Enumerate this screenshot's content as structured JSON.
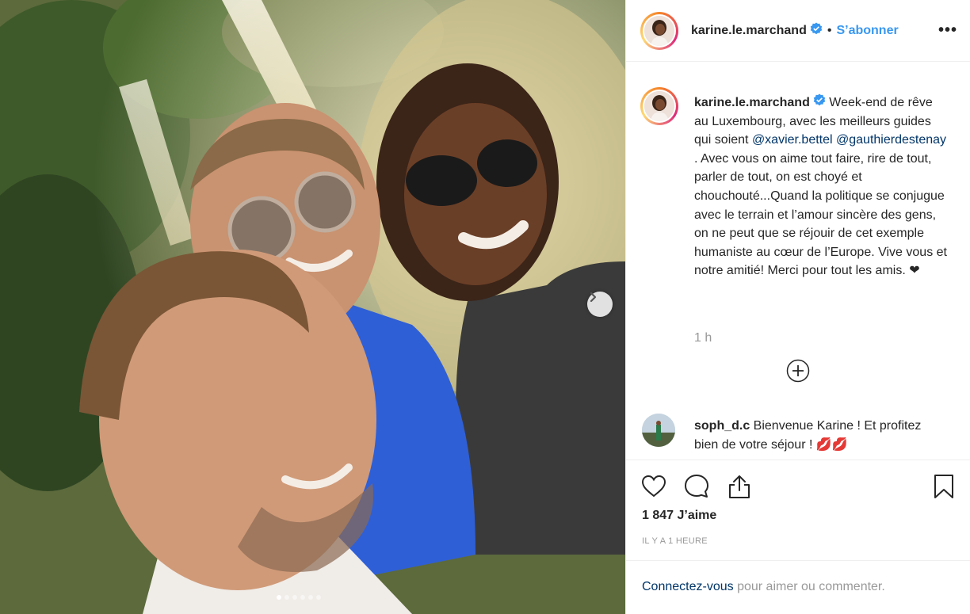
{
  "post": {
    "author": {
      "username": "karine.le.marchand",
      "verified": true,
      "avatar": "profile-photo"
    },
    "header": {
      "separator": "•",
      "follow_label": "S’abonner",
      "more_label": "•••"
    },
    "photo": {
      "alt": "selfie-waterfall",
      "carousel_count": 6,
      "carousel_active_index": 0,
      "next_icon": "chevron-right-icon"
    },
    "caption": {
      "username": "karine.le.marchand",
      "text_before": " Week-end de rêve au Luxembourg, avec les meilleurs guides qui soient ",
      "mention_1": "@xavier.bettel",
      "mention_2": "@gauthierdestenay",
      "text_after": " . Avec vous on aime tout faire, rire de tout, parler de tout, on est choyé et chouchouté...Quand la politique se conjugue avec le terrain et l’amour sincère des gens, on ne peut que se réjouir de cet exemple humaniste au cœur de l’Europe. Vive vous et notre amitié! Merci pour tout les amis. ❤",
      "time": "1 h"
    },
    "comments": [
      {
        "username": "soph_d.c",
        "text": " Bienvenue Karine ! Et profitez bien de votre séjour ! 💋💋"
      }
    ],
    "likes_label": "1 847 J’aime",
    "posted_label": "IL Y A 1 HEURE",
    "login": {
      "link": "Connectez-vous",
      "rest": " pour aimer ou commenter."
    },
    "icons": {
      "like": "heart-icon",
      "comment": "comment-bubble-icon",
      "share": "share-icon",
      "save": "bookmark-icon",
      "load_more": "plus-circle-icon"
    },
    "colors": {
      "link_blue": "#3897f0",
      "mention_blue": "#003569",
      "verified_blue": "#3897f0",
      "muted_gray": "#999999"
    }
  }
}
